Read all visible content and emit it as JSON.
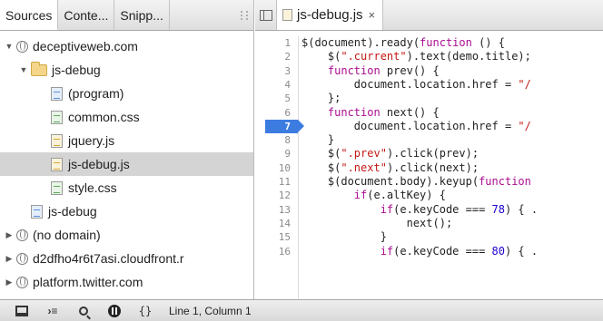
{
  "navigator": {
    "tabs": [
      {
        "label": "Sources",
        "active": true
      },
      {
        "label": "Conte...",
        "active": false
      },
      {
        "label": "Snipp...",
        "active": false
      }
    ],
    "tree": [
      {
        "label": "deceptiveweb.com",
        "depth": 0,
        "arrow": "down",
        "icon": "globe"
      },
      {
        "label": "js-debug",
        "depth": 1,
        "arrow": "down",
        "icon": "folder"
      },
      {
        "label": "(program)",
        "depth": 2,
        "arrow": "none",
        "icon": "doc"
      },
      {
        "label": "common.css",
        "depth": 2,
        "arrow": "none",
        "icon": "css"
      },
      {
        "label": "jquery.js",
        "depth": 2,
        "arrow": "none",
        "icon": "js"
      },
      {
        "label": "js-debug.js",
        "depth": 2,
        "arrow": "none",
        "icon": "js",
        "selected": true
      },
      {
        "label": "style.css",
        "depth": 2,
        "arrow": "none",
        "icon": "css"
      },
      {
        "label": "js-debug",
        "depth": 1,
        "arrow": "none",
        "icon": "doc"
      },
      {
        "label": "(no domain)",
        "depth": 0,
        "arrow": "right",
        "icon": "globe"
      },
      {
        "label": "d2dfho4r6t7asi.cloudfront.r",
        "depth": 0,
        "arrow": "right",
        "icon": "globe"
      },
      {
        "label": "platform.twitter.com",
        "depth": 0,
        "arrow": "right",
        "icon": "globe"
      }
    ]
  },
  "editor": {
    "tab_label": "js-debug.js",
    "close_glyph": "×",
    "breakpoint_line": 7,
    "line_numbers": [
      "1",
      "2",
      "3",
      "4",
      "5",
      "6",
      "7",
      "8",
      "9",
      "10",
      "11",
      "12",
      "13",
      "14",
      "15",
      "16"
    ],
    "lines": [
      "$(document).ready(function () {",
      "    $(\".current\").text(demo.title);",
      "    function prev() {",
      "        document.location.href = \"/",
      "    };",
      "    function next() {",
      "        document.location.href = \"/",
      "    }",
      "    $(\".prev\").click(prev);",
      "    $(\".next\").click(next);",
      "    $(document.body).keyup(function",
      "        if(e.altKey) {",
      "            if(e.keyCode === 78) { .",
      "                next();",
      "            }",
      "            if(e.keyCode === 80) { ."
    ]
  },
  "status_bar": {
    "dock_glyph": "",
    "console_glyph": "›≡",
    "pause_glyph": "",
    "pretty_print_glyph": "{}",
    "position": "Line 1, Column 1"
  }
}
